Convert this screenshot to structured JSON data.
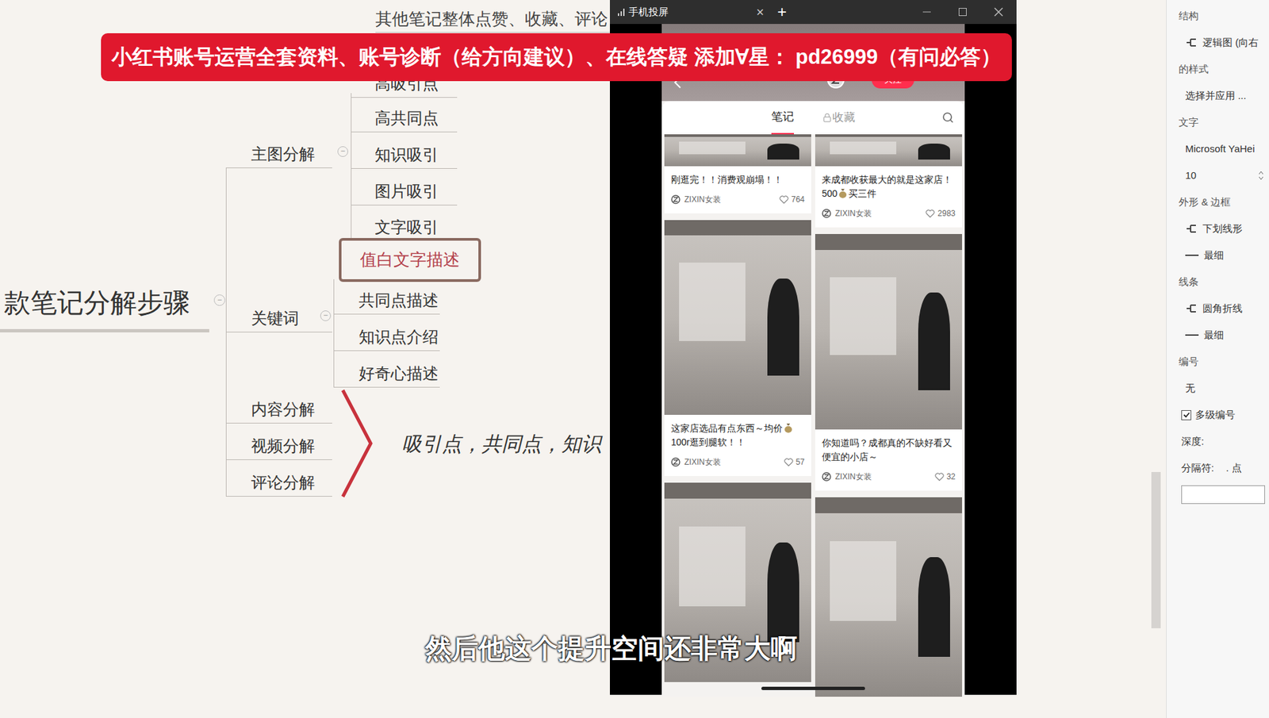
{
  "mindmap": {
    "top_text": "其他笔记整体点赞、收藏、评论",
    "root": "款笔记分解步骤",
    "branches": [
      {
        "label": "主图分解",
        "collapse": "−",
        "children": [
          {
            "label": "高吸引点",
            "selected": false
          },
          {
            "label": "高共同点",
            "selected": false
          },
          {
            "label": "知识吸引",
            "selected": false
          },
          {
            "label": "图片吸引",
            "selected": false
          },
          {
            "label": "文字吸引",
            "selected": false
          }
        ]
      },
      {
        "label": "关键词",
        "collapse": "−",
        "children": [
          {
            "label": "值白文字描述",
            "selected": true
          },
          {
            "label": "共同点描述",
            "selected": false
          },
          {
            "label": "知识点介绍",
            "selected": false
          },
          {
            "label": "好奇心描述",
            "selected": false
          }
        ]
      },
      {
        "label": "内容分解",
        "collapse": "",
        "children": []
      },
      {
        "label": "视频分解",
        "collapse": "",
        "children": []
      },
      {
        "label": "评论分解",
        "collapse": "",
        "children": []
      }
    ],
    "root_collapse": "−",
    "note": "吸引点，共同点，知识"
  },
  "phone_window": {
    "title": "手机投屏",
    "tab_close": "×",
    "new_tab": "+",
    "follow": "关注",
    "more": "···",
    "tabs": [
      {
        "label": "笔记",
        "selected": true,
        "locked": false
      },
      {
        "label": "收藏",
        "selected": false,
        "locked": true
      }
    ],
    "columns": [
      [
        {
          "kind": "note",
          "title_parts": [
            "刚逛完！！消费观崩塌！！"
          ],
          "author": "ZIXIN女装",
          "likes": "764"
        },
        {
          "kind": "note",
          "title_parts": [
            "这家店选品有点东西～均价",
            "100r逛到腿软！！"
          ],
          "author": "ZIXIN女装",
          "likes": "57"
        },
        {
          "kind": "image"
        }
      ],
      [
        {
          "kind": "note",
          "title_parts": [
            "来成都收获最大的就是这家店！500",
            "买三件"
          ],
          "author": "ZIXIN女装",
          "likes": "2983"
        },
        {
          "kind": "note",
          "title_parts": [
            "你知道吗？成都真的不缺好看又便宜的小店～"
          ],
          "author": "ZIXIN女装",
          "likes": "32"
        },
        {
          "kind": "image"
        }
      ]
    ]
  },
  "banner": "小红书账号运营全套资料、账号诊断（给方向建议）、在线答疑 添加∀星： pd26999（有问必答）",
  "subtitle": "然后他这个提升空间还非常大啊",
  "right_panel": [
    {
      "kind": "heading",
      "text": "结构"
    },
    {
      "kind": "option",
      "text": "逻辑图 (向右"
    },
    {
      "kind": "heading",
      "text": "的样式"
    },
    {
      "kind": "value",
      "text": "选择并应用 ..."
    },
    {
      "kind": "heading",
      "text": "文字"
    },
    {
      "kind": "value",
      "text": "Microsoft YaHei"
    },
    {
      "kind": "spinner",
      "text": "10"
    },
    {
      "kind": "heading",
      "text": "外形 & 边框"
    },
    {
      "kind": "option",
      "text": "下划线形"
    },
    {
      "kind": "line",
      "text": "最细"
    },
    {
      "kind": "heading",
      "text": "线条"
    },
    {
      "kind": "option",
      "text": "圆角折线"
    },
    {
      "kind": "line",
      "text": "最细"
    },
    {
      "kind": "heading",
      "text": "编号"
    },
    {
      "kind": "value",
      "text": "无"
    },
    {
      "kind": "checkbox",
      "text": "多级编号",
      "checked": true
    },
    {
      "kind": "label",
      "text": "深度:"
    },
    {
      "kind": "label",
      "text": "分隔符:",
      "value": ". 点"
    },
    {
      "kind": "field"
    }
  ]
}
